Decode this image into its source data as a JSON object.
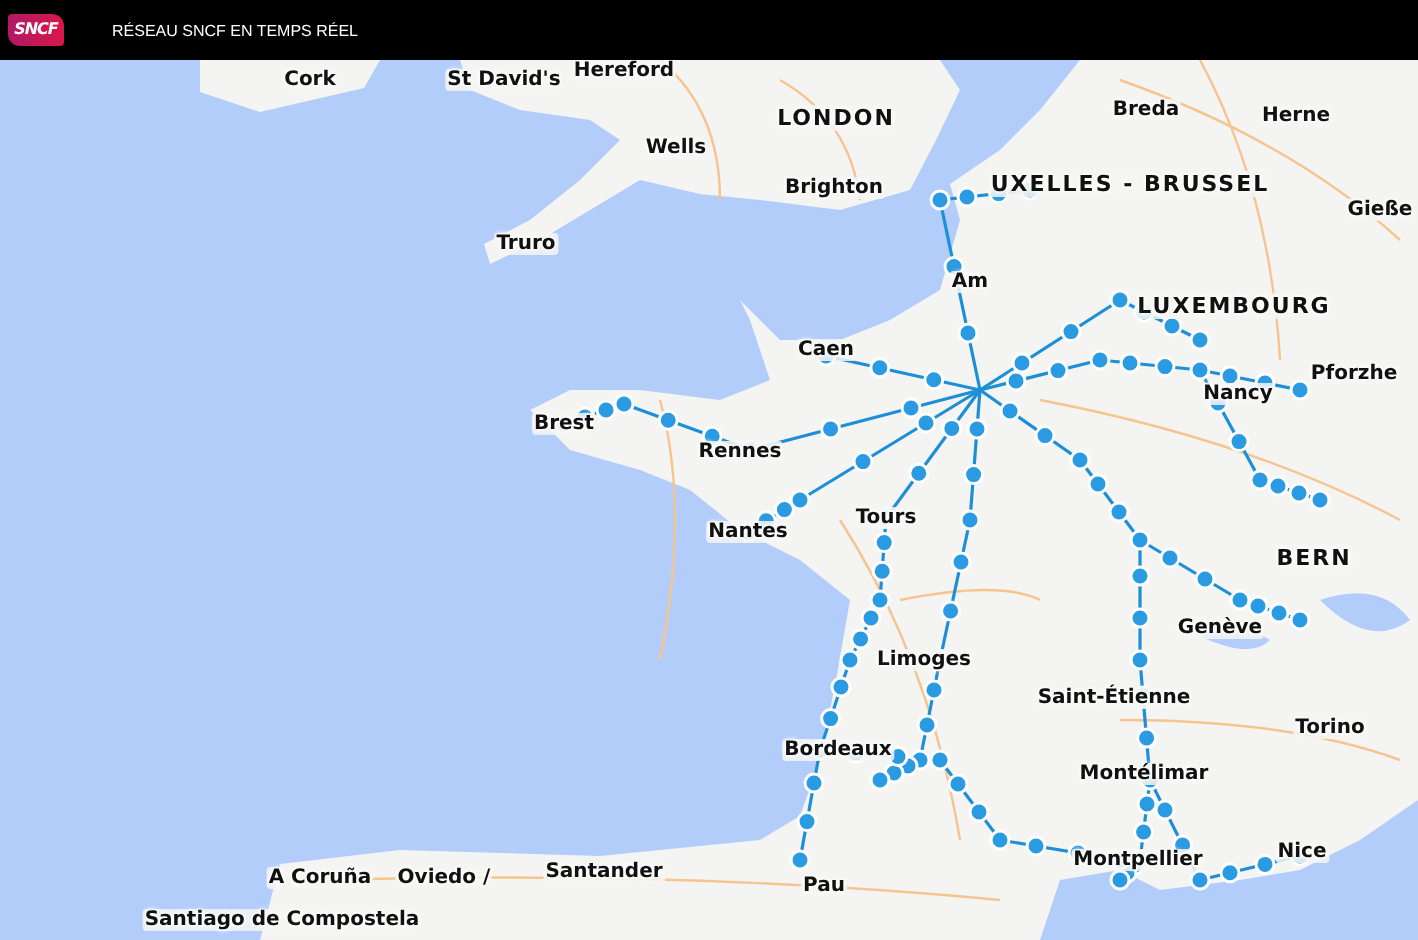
{
  "header": {
    "logo": "SNCF",
    "title": "RÉSEAU SNCF EN TEMPS RÉEL"
  },
  "map": {
    "labels": [
      {
        "text": "Cork",
        "kind": "city"
      },
      {
        "text": "St David's",
        "kind": "city"
      },
      {
        "text": "Hereford",
        "kind": "city"
      },
      {
        "text": "LONDON",
        "kind": "capital"
      },
      {
        "text": "Wells",
        "kind": "city"
      },
      {
        "text": "Brighton",
        "kind": "city"
      },
      {
        "text": "Truro",
        "kind": "city"
      },
      {
        "text": "Breda",
        "kind": "city"
      },
      {
        "text": "Herne",
        "kind": "city"
      },
      {
        "text": "UXELLES - BRUSSEL",
        "kind": "capital"
      },
      {
        "text": "Gieße",
        "kind": "city"
      },
      {
        "text": "Am",
        "kind": "city"
      },
      {
        "text": "LUXEMBOURG",
        "kind": "capital"
      },
      {
        "text": "Caen",
        "kind": "city"
      },
      {
        "text": "Pforzhe",
        "kind": "city"
      },
      {
        "text": "Nancy",
        "kind": "city"
      },
      {
        "text": "Brest",
        "kind": "city"
      },
      {
        "text": "Rennes",
        "kind": "city"
      },
      {
        "text": "Nantes",
        "kind": "city"
      },
      {
        "text": "Tours",
        "kind": "city"
      },
      {
        "text": "BERN",
        "kind": "capital"
      },
      {
        "text": "Genève",
        "kind": "city"
      },
      {
        "text": "Limoges",
        "kind": "city"
      },
      {
        "text": "Saint-Étienne",
        "kind": "city"
      },
      {
        "text": "Torino",
        "kind": "city"
      },
      {
        "text": "Bordeaux",
        "kind": "city"
      },
      {
        "text": "Montélimar",
        "kind": "city"
      },
      {
        "text": "Montpellier",
        "kind": "city"
      },
      {
        "text": "Nice",
        "kind": "city"
      },
      {
        "text": "A Coruña",
        "kind": "city"
      },
      {
        "text": "Oviedo /",
        "kind": "city"
      },
      {
        "text": "Santander",
        "kind": "city"
      },
      {
        "text": "Santiago de Compostela",
        "kind": "city"
      },
      {
        "text": "Pau",
        "kind": "city"
      }
    ]
  }
}
